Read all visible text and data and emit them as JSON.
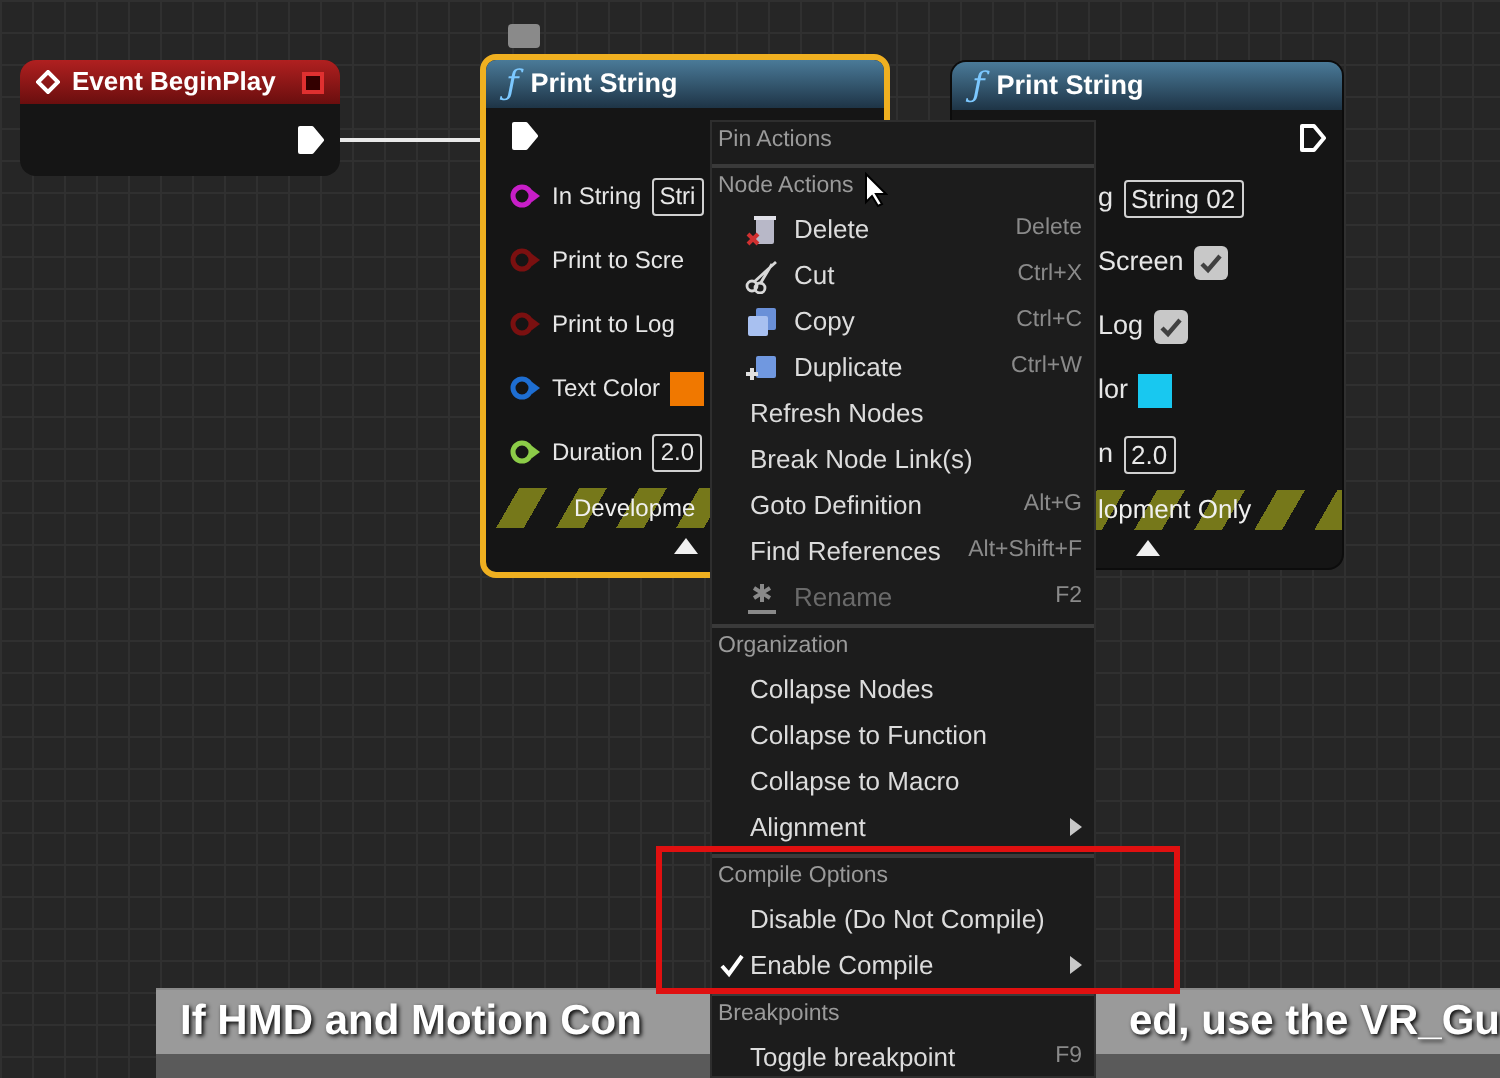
{
  "event_node": {
    "title": "Event BeginPlay",
    "exec_out": {
      "connected": true
    }
  },
  "print_nodes": [
    {
      "icon": "ƒ",
      "title": "Print String",
      "selected": true,
      "exec_in": {
        "connected": true
      },
      "rows": [
        {
          "kind": "text",
          "label": "In String",
          "pin": {
            "color": "#c81ec8"
          },
          "value": "Stri"
        },
        {
          "kind": "check",
          "label": "Print to Scre",
          "pin": {
            "color": "#7a1010"
          }
        },
        {
          "kind": "check",
          "label": "Print to Log",
          "pin": {
            "color": "#7a1010"
          }
        },
        {
          "kind": "swatch",
          "label": "Text Color",
          "pin": {
            "color": "#1e6ed2"
          },
          "swatch": {
            "color": "#f07800"
          }
        },
        {
          "kind": "text",
          "label": "Duration",
          "pin": {
            "color": "#8ccc48"
          },
          "value": "2.0"
        }
      ],
      "footer": "Developme"
    },
    {
      "icon": "ƒ",
      "title": "Print String",
      "selected": false,
      "exec_out": {
        "connected": false
      },
      "rows": [
        {
          "kind": "text",
          "label": "g",
          "value": "String 02"
        },
        {
          "kind": "check",
          "label": "Screen",
          "checked": true
        },
        {
          "kind": "check",
          "label": "Log",
          "checked": true
        },
        {
          "kind": "swatch",
          "label": "lor",
          "swatch": {
            "color": "#18c8f0"
          }
        },
        {
          "kind": "text",
          "label": "n",
          "value": "2.0"
        }
      ],
      "footer": "lopment Only"
    }
  ],
  "context_menu": {
    "sections": [
      {
        "heading": "Pin Actions"
      },
      {
        "heading": "Node Actions",
        "items": [
          {
            "label": "Delete",
            "shortcut": "Delete",
            "icon": true,
            "checked": false,
            "disabled": false,
            "submenu": false
          },
          {
            "label": "Cut",
            "shortcut": "Ctrl+X",
            "icon": true,
            "checked": false,
            "disabled": false,
            "submenu": false
          },
          {
            "label": "Copy",
            "shortcut": "Ctrl+C",
            "icon": true,
            "checked": false,
            "disabled": false,
            "submenu": false
          },
          {
            "label": "Duplicate",
            "shortcut": "Ctrl+W",
            "icon": true,
            "checked": false,
            "disabled": false,
            "submenu": false
          },
          {
            "label": "Refresh Nodes",
            "icon": false,
            "checked": false,
            "disabled": false,
            "submenu": false
          },
          {
            "label": "Break Node Link(s)",
            "icon": false,
            "checked": false,
            "disabled": false,
            "submenu": false
          },
          {
            "label": "Goto Definition",
            "shortcut": "Alt+G",
            "icon": false,
            "checked": false,
            "disabled": false,
            "submenu": false
          },
          {
            "label": "Find References",
            "shortcut": "Alt+Shift+F",
            "icon": false,
            "checked": false,
            "disabled": false,
            "submenu": false
          },
          {
            "label": "Rename",
            "shortcut": "F2",
            "icon": true,
            "checked": false,
            "disabled": true,
            "submenu": false
          }
        ]
      },
      {
        "heading": "Organization",
        "items": [
          {
            "label": "Collapse Nodes",
            "icon": false,
            "checked": false,
            "disabled": false,
            "submenu": false
          },
          {
            "label": "Collapse to Function",
            "icon": false,
            "checked": false,
            "disabled": false,
            "submenu": false
          },
          {
            "label": "Collapse to Macro",
            "icon": false,
            "checked": false,
            "disabled": false,
            "submenu": false
          },
          {
            "label": "Alignment",
            "icon": false,
            "checked": false,
            "disabled": false,
            "submenu": true
          }
        ]
      },
      {
        "heading": "Compile Options",
        "items": [
          {
            "label": "Disable (Do Not Compile)",
            "icon": false,
            "checked": false,
            "disabled": false,
            "submenu": false
          },
          {
            "label": "Enable Compile",
            "icon": false,
            "checked": true,
            "disabled": false,
            "submenu": true
          }
        ]
      },
      {
        "heading": "Breakpoints",
        "items": [
          {
            "label": "Toggle breakpoint",
            "shortcut": "F9",
            "icon": false,
            "checked": false,
            "disabled": false,
            "submenu": false
          }
        ]
      }
    ]
  },
  "comment": {
    "texts": [
      "If HMD and Motion Con",
      "ed, use the VR_Gu"
    ]
  }
}
